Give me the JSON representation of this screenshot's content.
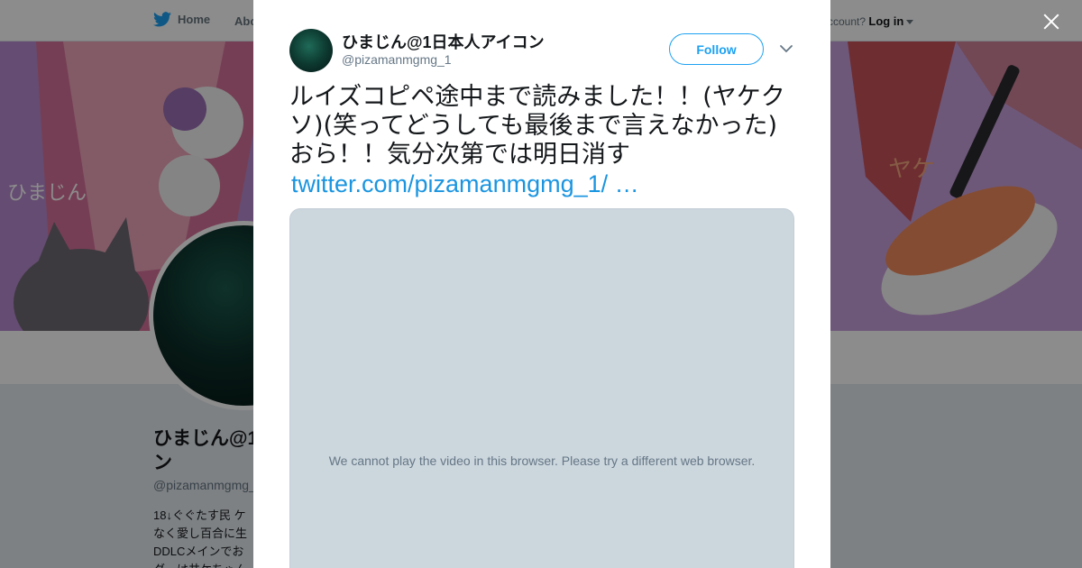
{
  "background": {
    "nav": {
      "home_label": "Home",
      "about_label": "Abo",
      "account_prompt": "ccount?",
      "login_label": "Log in"
    },
    "banner": {
      "text_left": "ひまじん",
      "text_right": "ヤケ"
    },
    "profile": {
      "name": "ひまじん@1\nン",
      "handle": "@pizamanmgmg_",
      "bio": "18↓ぐぐたす民 ケ\nなく愛し百合に生\nDDLCメインでお\nダーは井ケちゃん"
    }
  },
  "modal": {
    "author_name": "ひまじん@1日本人アイコン",
    "author_handle": "@pizamanmgmg_1",
    "follow_label": "Follow",
    "tweet_text": "ルイズコピペ途中まで読みました！！(ヤケクソ)(笑ってどうしても最後まで言えなかった)おら！！気分次第では明日消す",
    "tweet_link": "twitter.com/pizamanmgmg_1/ …",
    "video_message": "We cannot play the video in this browser. Please try a different web browser."
  },
  "icons": {
    "twitter_bird": "twitter-bird-icon",
    "close": "close-icon",
    "chevron": "chevron-down-icon"
  },
  "colors": {
    "twitter_blue": "#1da1f2",
    "link_blue": "#1b95e0",
    "media_placeholder": "#ccd6dd"
  }
}
